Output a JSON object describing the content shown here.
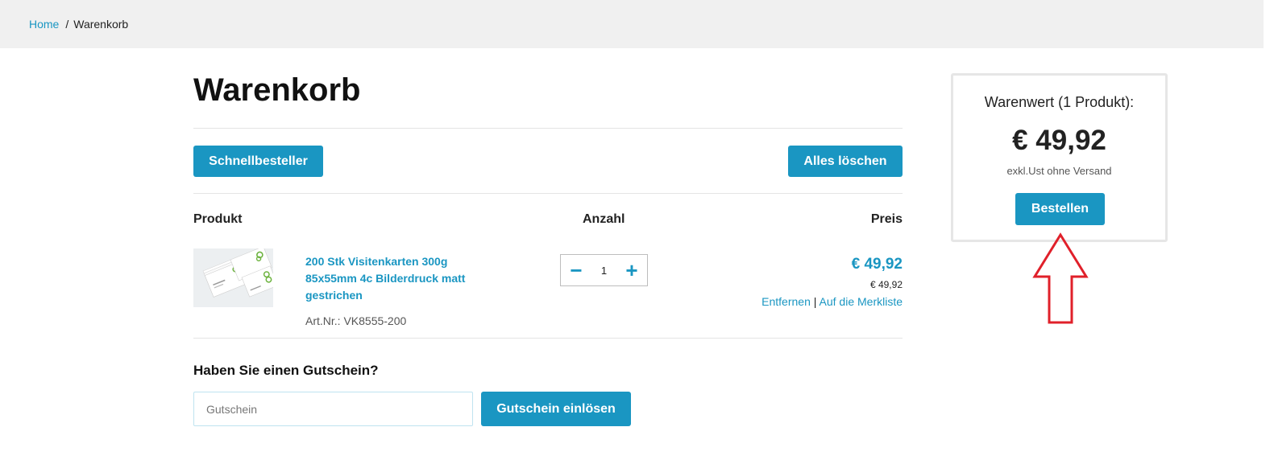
{
  "breadcrumb": {
    "home": "Home",
    "separator": "/",
    "current": "Warenkorb"
  },
  "page": {
    "title": "Warenkorb"
  },
  "toolbar": {
    "quick_order": "Schnellbesteller",
    "clear_all": "Alles löschen"
  },
  "table": {
    "col_product": "Produkt",
    "col_quantity": "Anzahl",
    "col_price": "Preis"
  },
  "item": {
    "name": "200 Stk Visitenkarten 300g 85x55mm 4c Bilderdruck matt gestrichen",
    "sku": "Art.Nr.: VK8555-200",
    "quantity": "1",
    "price": "€ 49,92",
    "unit_price": "€ 49,92",
    "remove_label": "Entfernen",
    "link_separator": "|",
    "wishlist_label": "Auf die Merkliste",
    "thumbnail_icon": "business-cards-image"
  },
  "coupon": {
    "heading": "Haben Sie einen Gutschein?",
    "placeholder": "Gutschein",
    "button": "Gutschein einlösen"
  },
  "summary": {
    "label": "Warenwert (1 Produkt):",
    "total": "€ 49,92",
    "note": "exkl.Ust ohne Versand",
    "order_button": "Bestellen"
  },
  "colors": {
    "accent": "#1a96c2",
    "annotation_arrow": "#e0202a"
  }
}
